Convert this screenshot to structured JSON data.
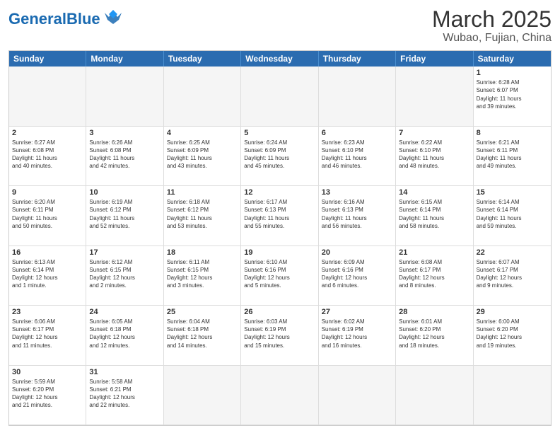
{
  "header": {
    "logo_general": "General",
    "logo_blue": "Blue",
    "title": "March 2025",
    "subtitle": "Wubao, Fujian, China"
  },
  "days": [
    "Sunday",
    "Monday",
    "Tuesday",
    "Wednesday",
    "Thursday",
    "Friday",
    "Saturday"
  ],
  "cells": [
    {
      "num": "",
      "info": "",
      "empty": true
    },
    {
      "num": "",
      "info": "",
      "empty": true
    },
    {
      "num": "",
      "info": "",
      "empty": true
    },
    {
      "num": "",
      "info": "",
      "empty": true
    },
    {
      "num": "",
      "info": "",
      "empty": true
    },
    {
      "num": "",
      "info": "",
      "empty": true
    },
    {
      "num": "1",
      "info": "Sunrise: 6:28 AM\nSunset: 6:07 PM\nDaylight: 11 hours\nand 39 minutes.",
      "empty": false
    },
    {
      "num": "2",
      "info": "Sunrise: 6:27 AM\nSunset: 6:08 PM\nDaylight: 11 hours\nand 40 minutes.",
      "empty": false
    },
    {
      "num": "3",
      "info": "Sunrise: 6:26 AM\nSunset: 6:08 PM\nDaylight: 11 hours\nand 42 minutes.",
      "empty": false
    },
    {
      "num": "4",
      "info": "Sunrise: 6:25 AM\nSunset: 6:09 PM\nDaylight: 11 hours\nand 43 minutes.",
      "empty": false
    },
    {
      "num": "5",
      "info": "Sunrise: 6:24 AM\nSunset: 6:09 PM\nDaylight: 11 hours\nand 45 minutes.",
      "empty": false
    },
    {
      "num": "6",
      "info": "Sunrise: 6:23 AM\nSunset: 6:10 PM\nDaylight: 11 hours\nand 46 minutes.",
      "empty": false
    },
    {
      "num": "7",
      "info": "Sunrise: 6:22 AM\nSunset: 6:10 PM\nDaylight: 11 hours\nand 48 minutes.",
      "empty": false
    },
    {
      "num": "8",
      "info": "Sunrise: 6:21 AM\nSunset: 6:11 PM\nDaylight: 11 hours\nand 49 minutes.",
      "empty": false
    },
    {
      "num": "9",
      "info": "Sunrise: 6:20 AM\nSunset: 6:11 PM\nDaylight: 11 hours\nand 50 minutes.",
      "empty": false
    },
    {
      "num": "10",
      "info": "Sunrise: 6:19 AM\nSunset: 6:12 PM\nDaylight: 11 hours\nand 52 minutes.",
      "empty": false
    },
    {
      "num": "11",
      "info": "Sunrise: 6:18 AM\nSunset: 6:12 PM\nDaylight: 11 hours\nand 53 minutes.",
      "empty": false
    },
    {
      "num": "12",
      "info": "Sunrise: 6:17 AM\nSunset: 6:13 PM\nDaylight: 11 hours\nand 55 minutes.",
      "empty": false
    },
    {
      "num": "13",
      "info": "Sunrise: 6:16 AM\nSunset: 6:13 PM\nDaylight: 11 hours\nand 56 minutes.",
      "empty": false
    },
    {
      "num": "14",
      "info": "Sunrise: 6:15 AM\nSunset: 6:14 PM\nDaylight: 11 hours\nand 58 minutes.",
      "empty": false
    },
    {
      "num": "15",
      "info": "Sunrise: 6:14 AM\nSunset: 6:14 PM\nDaylight: 11 hours\nand 59 minutes.",
      "empty": false
    },
    {
      "num": "16",
      "info": "Sunrise: 6:13 AM\nSunset: 6:14 PM\nDaylight: 12 hours\nand 1 minute.",
      "empty": false
    },
    {
      "num": "17",
      "info": "Sunrise: 6:12 AM\nSunset: 6:15 PM\nDaylight: 12 hours\nand 2 minutes.",
      "empty": false
    },
    {
      "num": "18",
      "info": "Sunrise: 6:11 AM\nSunset: 6:15 PM\nDaylight: 12 hours\nand 3 minutes.",
      "empty": false
    },
    {
      "num": "19",
      "info": "Sunrise: 6:10 AM\nSunset: 6:16 PM\nDaylight: 12 hours\nand 5 minutes.",
      "empty": false
    },
    {
      "num": "20",
      "info": "Sunrise: 6:09 AM\nSunset: 6:16 PM\nDaylight: 12 hours\nand 6 minutes.",
      "empty": false
    },
    {
      "num": "21",
      "info": "Sunrise: 6:08 AM\nSunset: 6:17 PM\nDaylight: 12 hours\nand 8 minutes.",
      "empty": false
    },
    {
      "num": "22",
      "info": "Sunrise: 6:07 AM\nSunset: 6:17 PM\nDaylight: 12 hours\nand 9 minutes.",
      "empty": false
    },
    {
      "num": "23",
      "info": "Sunrise: 6:06 AM\nSunset: 6:17 PM\nDaylight: 12 hours\nand 11 minutes.",
      "empty": false
    },
    {
      "num": "24",
      "info": "Sunrise: 6:05 AM\nSunset: 6:18 PM\nDaylight: 12 hours\nand 12 minutes.",
      "empty": false
    },
    {
      "num": "25",
      "info": "Sunrise: 6:04 AM\nSunset: 6:18 PM\nDaylight: 12 hours\nand 14 minutes.",
      "empty": false
    },
    {
      "num": "26",
      "info": "Sunrise: 6:03 AM\nSunset: 6:19 PM\nDaylight: 12 hours\nand 15 minutes.",
      "empty": false
    },
    {
      "num": "27",
      "info": "Sunrise: 6:02 AM\nSunset: 6:19 PM\nDaylight: 12 hours\nand 16 minutes.",
      "empty": false
    },
    {
      "num": "28",
      "info": "Sunrise: 6:01 AM\nSunset: 6:20 PM\nDaylight: 12 hours\nand 18 minutes.",
      "empty": false
    },
    {
      "num": "29",
      "info": "Sunrise: 6:00 AM\nSunset: 6:20 PM\nDaylight: 12 hours\nand 19 minutes.",
      "empty": false
    },
    {
      "num": "30",
      "info": "Sunrise: 5:59 AM\nSunset: 6:20 PM\nDaylight: 12 hours\nand 21 minutes.",
      "empty": false
    },
    {
      "num": "31",
      "info": "Sunrise: 5:58 AM\nSunset: 6:21 PM\nDaylight: 12 hours\nand 22 minutes.",
      "empty": false
    },
    {
      "num": "",
      "info": "",
      "empty": true
    },
    {
      "num": "",
      "info": "",
      "empty": true
    },
    {
      "num": "",
      "info": "",
      "empty": true
    },
    {
      "num": "",
      "info": "",
      "empty": true
    },
    {
      "num": "",
      "info": "",
      "empty": true
    }
  ]
}
